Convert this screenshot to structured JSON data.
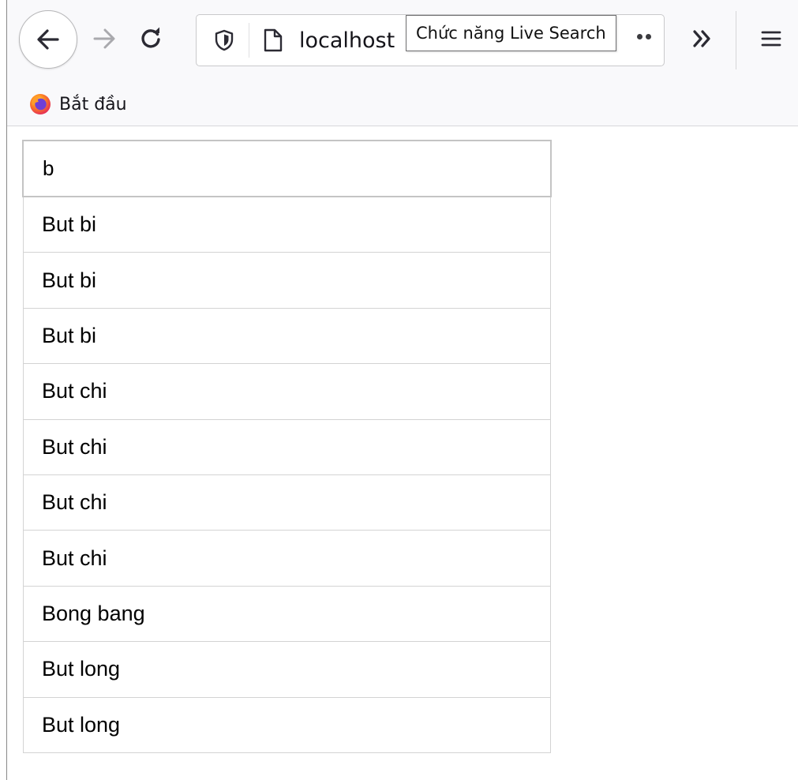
{
  "browser": {
    "url_text": "localhost",
    "tooltip": "Chức năng Live Search",
    "colors": {
      "toolbar_bg": "#f9f9fb",
      "icon": "#3b3b3f"
    },
    "icons": {
      "back": "arrow-left-icon",
      "forward": "arrow-right-icon",
      "reload": "reload-icon",
      "tracking_protection": "shield-icon",
      "page_info": "page-icon",
      "page_actions": "more-horizontal-icon",
      "overflow": "double-chevron-right-icon",
      "menu": "hamburger-menu-icon"
    }
  },
  "bookmarks": {
    "items": [
      {
        "label": "Bắt đầu",
        "icon": "firefox-logo-icon"
      }
    ]
  },
  "search": {
    "value": "b"
  },
  "results": [
    "But bi",
    "But bi",
    "But bi",
    "But chi",
    "But chi",
    "But chi",
    "But chi",
    "Bong bang",
    "But long",
    "But long"
  ]
}
